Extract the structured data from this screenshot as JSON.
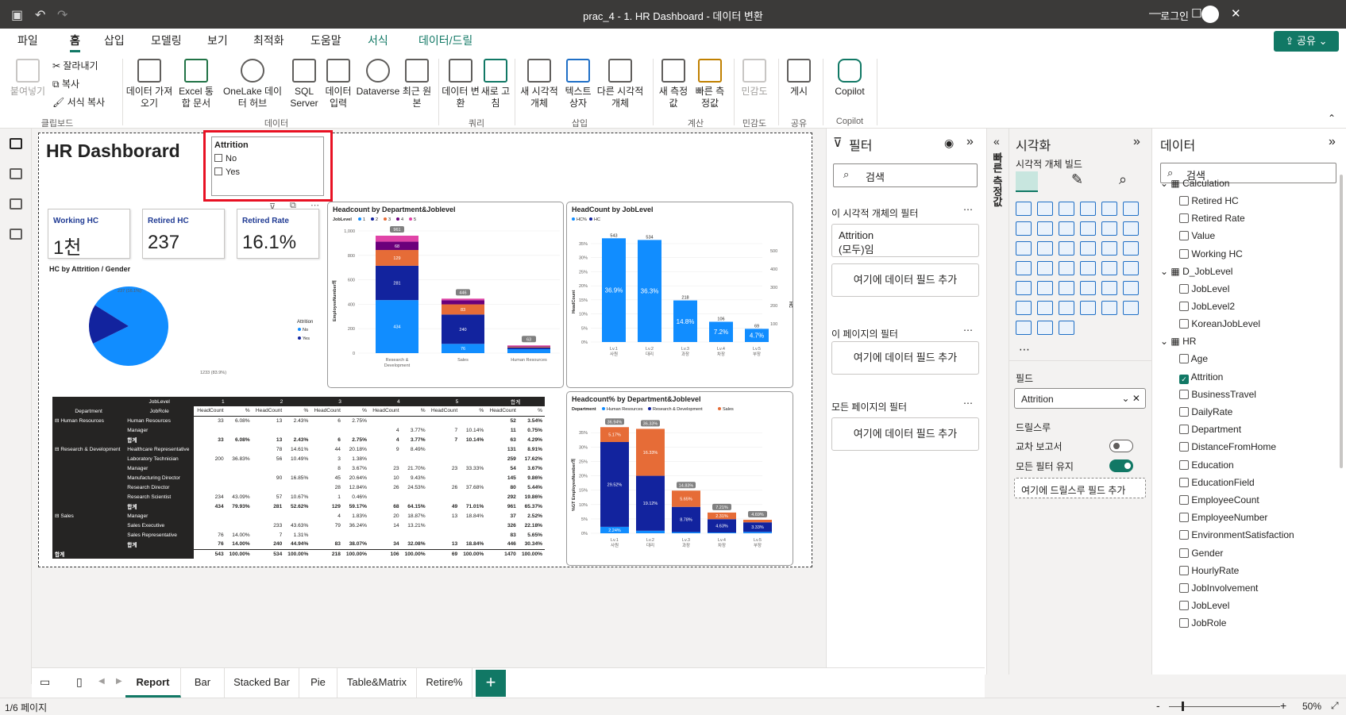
{
  "window": {
    "title": "prac_4 - 1. HR Dashboard - 데이터 변환",
    "login": "로그인"
  },
  "menu": {
    "items": [
      "파일",
      "홈",
      "삽입",
      "모델링",
      "보기",
      "최적화",
      "도움말",
      "서식",
      "데이터/드릴"
    ],
    "active": "홈",
    "share": "공유"
  },
  "ribbon": {
    "paste": "붙여넣기",
    "cut": "잘라내기",
    "copy": "복사",
    "format_copy": "서식 복사",
    "clipboard": "클립보드",
    "get_data": "데이터 가져오기",
    "excel": "Excel 통합 문서",
    "onelake": "OneLake 데이터 허브",
    "sql": "SQL Server",
    "enter_data": "데이터 입력",
    "dataverse": "Dataverse",
    "recent": "최근 원본",
    "data_group": "데이터",
    "transform": "데이터 변환",
    "refresh": "새로 고침",
    "query_group": "쿼리",
    "new_visual": "새 시각적 개체",
    "textbox": "텍스트 상자",
    "more_visuals": "다른 시각적 개체",
    "insert_group": "삽입",
    "new_measure": "새 측정값",
    "quick_measure": "빠른 측정값",
    "calc_group": "계산",
    "sensitivity": "민감도",
    "sens_group": "민감도",
    "publish": "게시",
    "share_group": "공유",
    "copilot": "Copilot",
    "copilot_group": "Copilot"
  },
  "report": {
    "title": "HR Dashborard",
    "slicer": {
      "title": "Attrition",
      "options": [
        "No",
        "Yes"
      ]
    },
    "cards": [
      {
        "label": "Working HC",
        "value": "1천"
      },
      {
        "label": "Retired HC",
        "value": "237"
      },
      {
        "label": "Retired Rate",
        "value": "16.1%"
      }
    ],
    "pie": {
      "title": "HC by Attrition / Gender",
      "legend_title": "Attrition",
      "legend": [
        "No",
        "Yes"
      ],
      "label_yes": "237 (16.1%)",
      "label_no": "1233 (83.9%)"
    },
    "dept_chart": {
      "title": "Headcount by Department&Joblevel",
      "legend_title": "JobLevel",
      "ylabel": "EmployeeNumber의"
    },
    "joblevel_chart": {
      "title": "HeadCount by JobLevel",
      "ylabel": "HeadCount",
      "y2label": "HC"
    },
    "pct_chart": {
      "title": "Headcount% by Department&Joblevel",
      "legend_title": "Department",
      "ylabel": "%GT EmployeeNumber의"
    }
  },
  "chart_data": [
    {
      "type": "bar",
      "title": "Headcount by Department&Joblevel",
      "stacked": true,
      "categories": [
        "Research & Development",
        "Sales",
        "Human Resources"
      ],
      "series": [
        {
          "name": "1",
          "values": [
            434,
            76,
            33
          ],
          "color": "#118dff"
        },
        {
          "name": "2",
          "values": [
            281,
            240,
            13
          ],
          "color": "#12239e"
        },
        {
          "name": "3",
          "values": [
            129,
            83,
            6
          ],
          "color": "#e66c37"
        },
        {
          "name": "4",
          "values": [
            68,
            34,
            4
          ],
          "color": "#6b007b"
        },
        {
          "name": "5",
          "values": [
            49,
            13,
            7
          ],
          "color": "#e044a7"
        }
      ],
      "totals": [
        961,
        446,
        63
      ],
      "ylim": [
        0,
        1000
      ],
      "yticks": [
        0,
        200,
        400,
        600,
        800,
        "1,000"
      ]
    },
    {
      "type": "bar",
      "title": "HeadCount by JobLevel",
      "categories": [
        "Lv.1 사원",
        "Lv.2 대리",
        "Lv.3 과장",
        "Lv.4 차장",
        "Lv.5 부장"
      ],
      "series": [
        {
          "name": "HC%",
          "values": [
            36.9,
            36.3,
            14.8,
            7.2,
            4.7
          ],
          "color": "#118dff"
        },
        {
          "name": "HC",
          "values": [
            543,
            534,
            218,
            106,
            69
          ],
          "color": "#12239e"
        }
      ],
      "labels_pct": [
        "36.9%",
        "36.3%",
        "14.8%",
        "7.2%",
        "4.7%"
      ],
      "labels_hc": [
        "543",
        "534",
        "218",
        "106",
        "69"
      ],
      "yticks": [
        "0%",
        "5%",
        "10%",
        "15%",
        "20%",
        "25%",
        "30%",
        "35%"
      ],
      "y2ticks": [
        "100",
        "200",
        "300",
        "400",
        "500"
      ],
      "ylim": [
        0,
        35
      ]
    },
    {
      "type": "bar",
      "title": "Headcount% by Department&Joblevel",
      "stacked": true,
      "categories": [
        "Lv.1 사원",
        "Lv.2 대리",
        "Lv.3 과장",
        "Lv.4 차장",
        "Lv.5 부장"
      ],
      "series": [
        {
          "name": "Human Resources",
          "values": [
            2.24,
            0.88,
            0.41,
            0.27,
            0.48
          ],
          "color": "#118dff"
        },
        {
          "name": "Research & Development",
          "values": [
            29.52,
            19.12,
            8.78,
            4.63,
            3.33
          ],
          "color": "#12239e"
        },
        {
          "name": "Sales",
          "values": [
            5.17,
            16.33,
            5.65,
            2.31,
            0.88
          ],
          "color": "#e66c37"
        }
      ],
      "labels": {
        "Human Resources": [
          "2.24%",
          "",
          "",
          "",
          ""
        ],
        "Research & Development": [
          "29.52%",
          "19.12%",
          "8.78%",
          "4.63%",
          "3.33%"
        ],
        "Sales": [
          "5.17%",
          "16.33%",
          "5.65%",
          "2.31%",
          ""
        ]
      },
      "totals": [
        "36.94%",
        "36.33%",
        "14.83%",
        "7.21%",
        "4.69%"
      ],
      "yticks": [
        "0%",
        "5%",
        "10%",
        "15%",
        "20%",
        "25%",
        "30%",
        "35%"
      ],
      "ylim": [
        0,
        37
      ]
    },
    {
      "type": "pie",
      "title": "HC by Attrition / Gender",
      "categories": [
        "No",
        "Yes"
      ],
      "values": [
        1233,
        237
      ],
      "colors": [
        "#118dff",
        "#12239e"
      ]
    }
  ],
  "matrix": {
    "header1": [
      "JobLevel",
      "1",
      "2",
      "3",
      "4",
      "5",
      "합계"
    ],
    "header2": [
      "Department",
      "JobRole",
      "HeadCount",
      "%",
      "HeadCount",
      "%",
      "HeadCount",
      "%",
      "HeadCount",
      "%",
      "HeadCount",
      "%",
      "HeadCount",
      "%"
    ],
    "rows": [
      {
        "dept": "⊟ Human Resources",
        "role": "Human Resources",
        "cells": [
          "33",
          "6.08%",
          "13",
          "2.43%",
          "6",
          "2.75%",
          "",
          "",
          "",
          "",
          "52",
          "3.54%"
        ]
      },
      {
        "dept": "",
        "role": "Manager",
        "cells": [
          "",
          "",
          "",
          "",
          "",
          "",
          "4",
          "3.77%",
          "7",
          "10.14%",
          "11",
          "0.75%"
        ]
      },
      {
        "dept": "",
        "role": "합계",
        "total": true,
        "cells": [
          "33",
          "6.08%",
          "13",
          "2.43%",
          "6",
          "2.75%",
          "4",
          "3.77%",
          "7",
          "10.14%",
          "63",
          "4.29%"
        ]
      },
      {
        "dept": "⊟ Research & Development",
        "role": "Healthcare Representative",
        "cells": [
          "",
          "",
          "78",
          "14.61%",
          "44",
          "20.18%",
          "9",
          "8.49%",
          "",
          "",
          "131",
          "8.91%"
        ]
      },
      {
        "dept": "",
        "role": "Laboratory Technician",
        "cells": [
          "200",
          "36.83%",
          "56",
          "10.49%",
          "3",
          "1.38%",
          "",
          "",
          "",
          "",
          "259",
          "17.62%"
        ]
      },
      {
        "dept": "",
        "role": "Manager",
        "cells": [
          "",
          "",
          "",
          "",
          "8",
          "3.67%",
          "23",
          "21.70%",
          "23",
          "33.33%",
          "54",
          "3.67%"
        ]
      },
      {
        "dept": "",
        "role": "Manufacturing Director",
        "cells": [
          "",
          "",
          "90",
          "16.85%",
          "45",
          "20.64%",
          "10",
          "9.43%",
          "",
          "",
          "145",
          "9.86%"
        ]
      },
      {
        "dept": "",
        "role": "Research Director",
        "cells": [
          "",
          "",
          "",
          "",
          "28",
          "12.84%",
          "26",
          "24.53%",
          "26",
          "37.68%",
          "80",
          "5.44%"
        ]
      },
      {
        "dept": "",
        "role": "Research Scientist",
        "cells": [
          "234",
          "43.09%",
          "57",
          "10.67%",
          "1",
          "0.46%",
          "",
          "",
          "",
          "",
          "292",
          "19.86%"
        ]
      },
      {
        "dept": "",
        "role": "합계",
        "total": true,
        "cells": [
          "434",
          "79.93%",
          "281",
          "52.62%",
          "129",
          "59.17%",
          "68",
          "64.15%",
          "49",
          "71.01%",
          "961",
          "65.37%"
        ]
      },
      {
        "dept": "⊟ Sales",
        "role": "Manager",
        "cells": [
          "",
          "",
          "",
          "",
          "4",
          "1.83%",
          "20",
          "18.87%",
          "13",
          "18.84%",
          "37",
          "2.52%"
        ]
      },
      {
        "dept": "",
        "role": "Sales Executive",
        "cells": [
          "",
          "",
          "233",
          "43.63%",
          "79",
          "36.24%",
          "14",
          "13.21%",
          "",
          "",
          "326",
          "22.18%"
        ]
      },
      {
        "dept": "",
        "role": "Sales Representative",
        "cells": [
          "76",
          "14.00%",
          "7",
          "1.31%",
          "",
          "",
          "",
          "",
          "",
          "",
          "83",
          "5.65%"
        ]
      },
      {
        "dept": "",
        "role": "합계",
        "total": true,
        "cells": [
          "76",
          "14.00%",
          "240",
          "44.94%",
          "83",
          "38.07%",
          "34",
          "32.08%",
          "13",
          "18.84%",
          "446",
          "30.34%"
        ]
      }
    ],
    "grand": {
      "label": "합계",
      "cells": [
        "543",
        "100.00%",
        "534",
        "100.00%",
        "218",
        "100.00%",
        "106",
        "100.00%",
        "69",
        "100.00%",
        "1470",
        "100.00%"
      ]
    }
  },
  "filters": {
    "title": "필터",
    "search": "검색",
    "visual_section": "이 시각적 개체의 필터",
    "attrition_filter": "Attrition",
    "attrition_state": "(모두)임",
    "add_field": "여기에 데이터 필드 추가",
    "page_section": "이 페이지의 필터",
    "all_section": "모든 페이지의 필터"
  },
  "quick_measure": "빠른 측정값",
  "viz": {
    "title": "시각화",
    "build": "시각적 개체 빌드",
    "fields_label": "필드",
    "field_value": "Attrition",
    "drill_label": "드릴스루",
    "cross_report": "교차 보고서",
    "keep_filters": "모든 필터 유지",
    "drill_add": "여기에 드릴스루 필드 추가",
    "cross_report_on": false,
    "keep_filters_on": true
  },
  "data": {
    "title": "데이터",
    "search": "검색",
    "tables": [
      {
        "name": "Calculation",
        "fields": [
          "Retired HC",
          "Retired Rate",
          "Value",
          "Working HC"
        ]
      },
      {
        "name": "D_JobLevel",
        "fields": [
          "JobLevel",
          "JobLevel2",
          "KoreanJobLevel"
        ]
      },
      {
        "name": "HR",
        "fields": [
          "Age",
          "Attrition",
          "BusinessTravel",
          "DailyRate",
          "Department",
          "DistanceFromHome",
          "Education",
          "EducationField",
          "EmployeeCount",
          "EmployeeNumber",
          "EnvironmentSatisfaction",
          "Gender",
          "HourlyRate",
          "JobInvolvement",
          "JobLevel",
          "JobRole"
        ]
      }
    ],
    "checked": "Attrition"
  },
  "tabs": [
    "Report",
    "Bar",
    "Stacked Bar",
    "Pie",
    "Table&Matrix",
    "Retire%"
  ],
  "active_tab": "Report",
  "status": {
    "page": "1/6 페이지",
    "zoom": "50%"
  }
}
